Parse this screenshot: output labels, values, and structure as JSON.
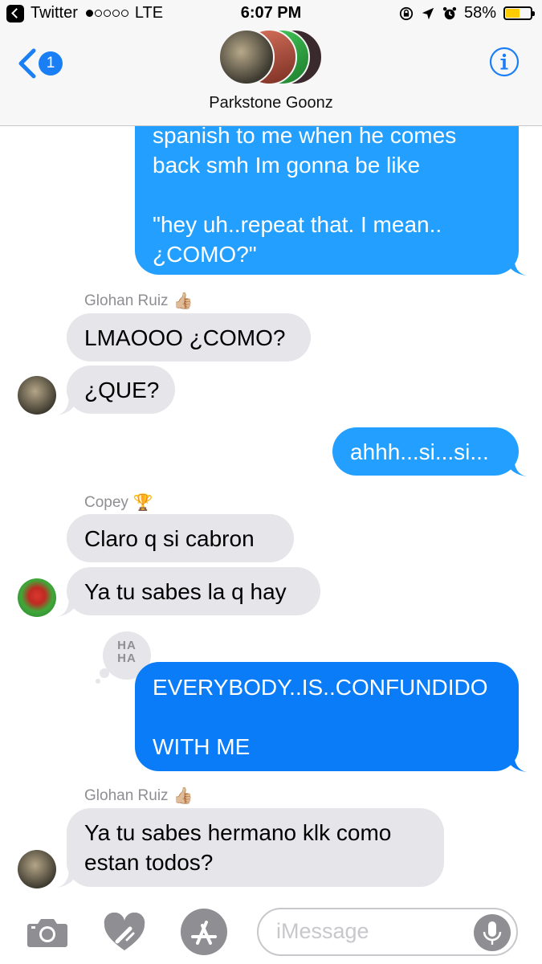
{
  "status_bar": {
    "back_app": "Twitter",
    "carrier": "LTE",
    "time": "6:07 PM",
    "battery_percent": "58%",
    "battery_level": 0.58
  },
  "header": {
    "back_badge_count": "1",
    "group_name": "Parkstone Goonz"
  },
  "messages": {
    "m1_lines": [
      "spanish to me when he comes",
      "back smh Im gonna be like",
      "",
      "\"hey uh..repeat that. I mean..",
      "¿COMO?\""
    ],
    "sender1": "Glohan Ruiz",
    "sender1_emoji": "👍🏼",
    "m2": "LMAOOO ¿COMO?",
    "m3": "¿QUE?",
    "m4": "ahhh...si...si...",
    "sender2": "Copey",
    "sender2_emoji": "🏆",
    "m5": "Claro q si cabron",
    "m6": "Ya tu sabes la q hay",
    "tapback": "HA HA",
    "m7_lines": [
      "EVERYBODY..IS..CONFUNDIDO",
      "",
      "WITH ME"
    ],
    "sender3": "Glohan Ruiz",
    "sender3_emoji": "👍🏼",
    "m8_lines": [
      "Ya tu sabes hermano klk como",
      "estan todos?"
    ]
  },
  "input": {
    "placeholder": "iMessage"
  },
  "colors": {
    "imessage_blue": "#23a0ff",
    "imessage_blue_dark": "#0a7cf7",
    "incoming_gray": "#e5e5ea",
    "link_blue": "#1a7ff5"
  }
}
